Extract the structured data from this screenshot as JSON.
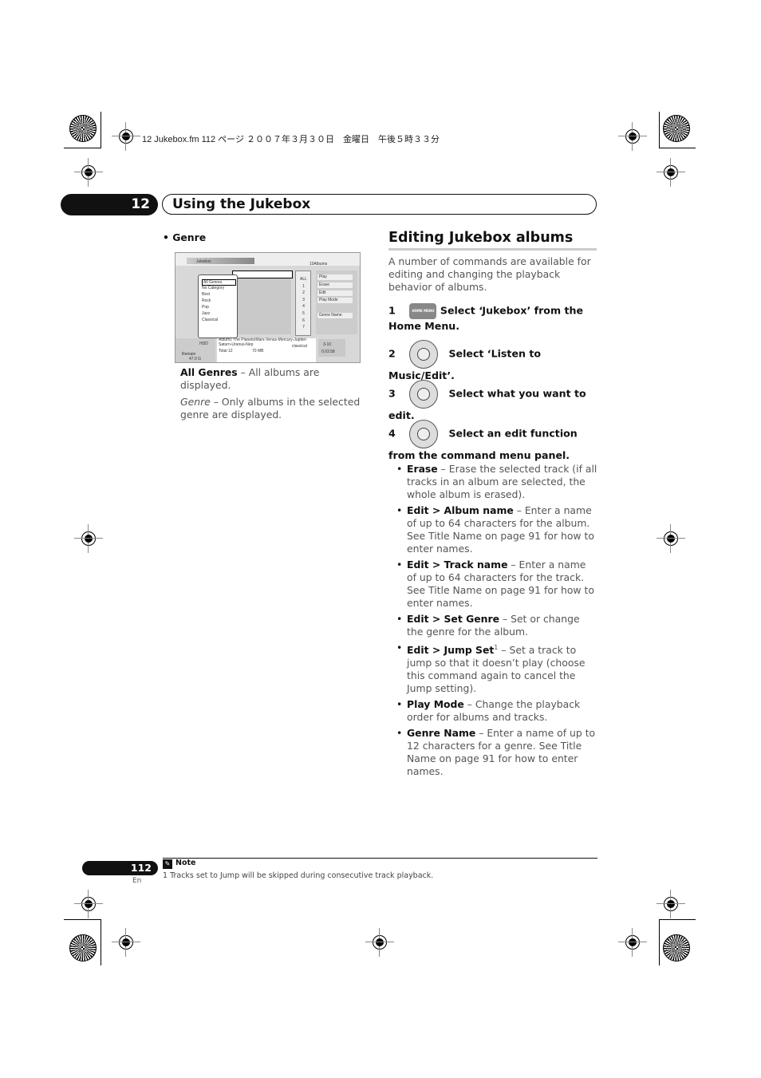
{
  "print_header": "12 Jukebox.fm 112 ページ ２００７年３月３０日　金曜日　午後５時３３分",
  "chapter": {
    "number": "12",
    "title": "Using the Jukebox"
  },
  "left": {
    "bullet": "Genre",
    "screen": {
      "title": "Jukebox",
      "count": "10Albums",
      "genres": [
        "All Genres",
        "No Category",
        "Best",
        "Rock",
        "Pop",
        "Jazz",
        "Classical"
      ],
      "numbers": [
        "ALL",
        "1",
        "2",
        "3",
        "4",
        "5",
        "6",
        "7"
      ],
      "commands": [
        "Play",
        "Erase",
        "Edit",
        "Play Mode",
        "Genre Name"
      ],
      "album_info": "Album1  The Planets/Mars-Venus-Mercury-Jupiter-Saturn-Uranus-Nep",
      "genre_tag": "classical",
      "total": "Total 12",
      "size": "70 MB",
      "device": "HDD",
      "remain_label": "Remain",
      "remain": "47.0 G",
      "track": "3-10",
      "time": "0.03.58"
    },
    "items": [
      {
        "term": "All Genres",
        "desc": " – All albums are displayed."
      },
      {
        "term": "Genre",
        "desc": " – Only albums in the selected genre are displayed."
      }
    ]
  },
  "section": {
    "title": "Editing Jukebox albums",
    "intro": "A number of commands are available for editing and changing the playback behavior of albums.",
    "steps": [
      {
        "num": "1",
        "icon": "home-menu-button",
        "text": "Select ‘Jukebox’ from the Home Menu.",
        "key_label": "HOME MENU"
      },
      {
        "num": "2",
        "icon": "dial",
        "text": "Select ‘Listen to Music/Edit’."
      },
      {
        "num": "3",
        "icon": "dial",
        "text": "Select what you want to edit."
      },
      {
        "num": "4",
        "icon": "dial",
        "text": "Select an edit function from the command menu panel."
      }
    ],
    "bullets": [
      {
        "term": "Erase",
        "desc": " – Erase the selected track (if all tracks in an album are selected, the whole album is erased)."
      },
      {
        "term": "Edit > Album name",
        "desc": " – Enter a name of up to 64 characters for the album. See Title Name on page 91 for how to enter names."
      },
      {
        "term": "Edit > Track name",
        "desc": " – Enter a name of up to 64 characters for the track. See Title Name on page 91 for how to enter names."
      },
      {
        "term": "Edit > Set Genre",
        "desc": " – Set or change the genre for the album."
      },
      {
        "term": "Edit > Jump Set",
        "sup": "1",
        "desc": " – Set a track to jump so that it doesn’t play (choose this command again to cancel the Jump setting)."
      },
      {
        "term": "Play Mode",
        "desc": " – Change the playback order for albums and tracks."
      },
      {
        "term": "Genre Name",
        "desc": " – Enter a name of up to 12 characters for a genre. See Title Name on page 91 for how to enter names."
      }
    ]
  },
  "footer": {
    "page": "112",
    "lang": "En",
    "note_label": "Note",
    "note": "1 Tracks set to Jump will be skipped during consecutive track playback."
  }
}
